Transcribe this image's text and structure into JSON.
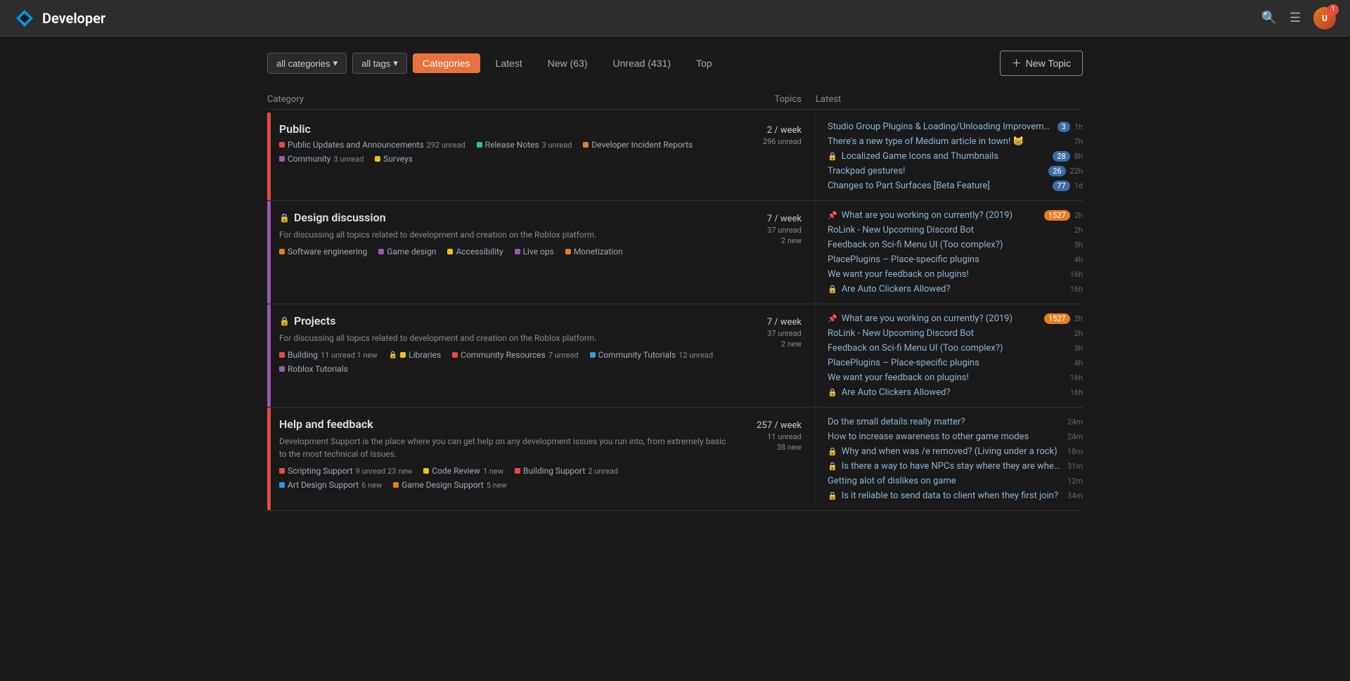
{
  "header": {
    "title": "Developer",
    "search_icon": "🔍",
    "menu_icon": "☰",
    "notification_count": "1"
  },
  "toolbar": {
    "all_categories_label": "all categories",
    "all_tags_label": "all tags",
    "tabs": [
      {
        "id": "categories",
        "label": "Categories",
        "active": true
      },
      {
        "id": "latest",
        "label": "Latest",
        "active": false
      },
      {
        "id": "new",
        "label": "New (63)",
        "active": false
      },
      {
        "id": "unread",
        "label": "Unread (431)",
        "active": false
      },
      {
        "id": "top",
        "label": "Top",
        "active": false
      }
    ],
    "new_topic_label": "New Topic"
  },
  "table": {
    "col_category": "Category",
    "col_topics": "Topics",
    "col_latest": "Latest"
  },
  "categories": [
    {
      "id": "public",
      "name": "Public",
      "color": "#e74c3c",
      "locked": false,
      "stats": {
        "per_week": "2 / week",
        "unread": "296 unread"
      },
      "subcats": [
        {
          "color": "#e74c3c",
          "name": "Public Updates and Announcements",
          "count": "292 unread"
        },
        {
          "color": "#2ecc71",
          "name": "Release Notes",
          "count": "3 unread"
        },
        {
          "color": "#e67e22",
          "name": "Developer Incident Reports",
          "count": ""
        },
        {
          "color": "#9b59b6",
          "name": "Community",
          "count": "3 unread"
        },
        {
          "color": "#f1c40f",
          "name": "Surveys",
          "count": ""
        }
      ],
      "latest": [
        {
          "title": "Studio Group Plugins & Loading/Unloading Improvements",
          "time": "1h",
          "badge": "3",
          "badge_type": "blue",
          "pinned": false,
          "locked": false
        },
        {
          "title": "There's a new type of Medium article in town! 😸",
          "time": "7h",
          "badge": "",
          "badge_type": "",
          "pinned": false,
          "locked": false
        },
        {
          "title": "Localized Game Icons and Thumbnails",
          "time": "8h",
          "badge": "28",
          "badge_type": "blue",
          "pinned": false,
          "locked": true
        },
        {
          "title": "Trackpad gestures!",
          "time": "22h",
          "badge": "26",
          "badge_type": "blue",
          "pinned": false,
          "locked": false
        },
        {
          "title": "Changes to Part Surfaces [Beta Feature]",
          "time": "1d",
          "badge": "77",
          "badge_type": "blue",
          "pinned": false,
          "locked": false
        }
      ]
    },
    {
      "id": "design-discussion",
      "name": "Design discussion",
      "color": "#9b59b6",
      "locked": true,
      "description": "For discussing all topics related to development and creation on the Roblox platform.",
      "stats": {
        "per_week": "7 / week",
        "unread": "37 unread",
        "new": "2 new"
      },
      "subcats": [
        {
          "color": "#e67e22",
          "name": "Software engineering",
          "count": ""
        },
        {
          "color": "#9b59b6",
          "name": "Game design",
          "count": ""
        },
        {
          "color": "#f1c40f",
          "name": "Accessibility",
          "count": ""
        },
        {
          "color": "#9b59b6",
          "name": "Live ops",
          "count": ""
        },
        {
          "color": "#e67e22",
          "name": "Monetization",
          "count": ""
        }
      ],
      "latest": [
        {
          "title": "What are you working on currently? (2019)",
          "time": "2h",
          "badge": "1527",
          "badge_type": "orange",
          "pinned": true,
          "locked": false
        },
        {
          "title": "RoLink - New Upcoming Discord Bot",
          "time": "2h",
          "badge": "",
          "badge_type": "",
          "pinned": false,
          "locked": false
        },
        {
          "title": "Feedback on Sci-fi Menu UI (Too complex?)",
          "time": "3h",
          "badge": "",
          "badge_type": "",
          "pinned": false,
          "locked": false
        },
        {
          "title": "PlacePlugins – Place-specific plugins",
          "time": "4h",
          "badge": "",
          "badge_type": "",
          "pinned": false,
          "locked": false
        },
        {
          "title": "We want your feedback on plugins!",
          "time": "16h",
          "badge": "",
          "badge_type": "",
          "pinned": false,
          "locked": false
        },
        {
          "title": "Are Auto Clickers Allowed?",
          "time": "16h",
          "badge": "",
          "badge_type": "",
          "pinned": false,
          "locked": true
        }
      ]
    },
    {
      "id": "projects",
      "name": "Projects",
      "color": "#9b59b6",
      "locked": true,
      "description": "For discussing all topics related to development and creation on the Roblox platform.",
      "stats": {
        "per_week": "7 / week",
        "unread": "37 unread",
        "new": "2 new"
      },
      "subcats": [
        {
          "color": "#e74c3c",
          "name": "Building",
          "count": "11 unread",
          "extra": "1 new"
        },
        {
          "color": "#f1c40f",
          "name": "Libraries",
          "count": "",
          "locked": true
        },
        {
          "color": "#e74c3c",
          "name": "Community Resources",
          "count": "7 unread"
        },
        {
          "color": "#3498db",
          "name": "Community Tutorials",
          "count": "12 unread"
        },
        {
          "color": "#9b59b6",
          "name": "Roblox Tutorials",
          "count": ""
        }
      ],
      "latest": [
        {
          "title": "What are you working on currently? (2019)",
          "time": "2h",
          "badge": "1527",
          "badge_type": "orange",
          "pinned": true,
          "locked": false
        },
        {
          "title": "RoLink - New Upcoming Discord Bot",
          "time": "2h",
          "badge": "",
          "badge_type": "",
          "pinned": false,
          "locked": false
        },
        {
          "title": "Feedback on Sci-fi Menu UI (Too complex?)",
          "time": "3h",
          "badge": "",
          "badge_type": "",
          "pinned": false,
          "locked": false
        },
        {
          "title": "PlacePlugins – Place-specific plugins",
          "time": "4h",
          "badge": "",
          "badge_type": "",
          "pinned": false,
          "locked": false
        },
        {
          "title": "We want your feedback on plugins!",
          "time": "16h",
          "badge": "",
          "badge_type": "",
          "pinned": false,
          "locked": false
        },
        {
          "title": "Are Auto Clickers Allowed?",
          "time": "16h",
          "badge": "",
          "badge_type": "",
          "pinned": false,
          "locked": true
        }
      ]
    },
    {
      "id": "help-and-feedback",
      "name": "Help and feedback",
      "color": "#e74c3c",
      "locked": false,
      "description": "Development Support is the place where you can get help on any development issues you run into, from extremely basic to the most technical of issues.",
      "stats": {
        "per_week": "257 / week",
        "unread": "11 unread",
        "new": "38 new"
      },
      "subcats": [
        {
          "color": "#e74c3c",
          "name": "Scripting Support",
          "count": "9 unread",
          "extra": "23 new"
        },
        {
          "color": "#f1c40f",
          "name": "Code Review",
          "count": "1 new"
        },
        {
          "color": "#e74c3c",
          "name": "Building Support",
          "count": "2 unread",
          "extra": ""
        },
        {
          "color": "#3498db",
          "name": "Art Design Support",
          "count": "6 new"
        },
        {
          "color": "#e67e22",
          "name": "Game Design Support",
          "count": "5 new"
        }
      ],
      "latest": [
        {
          "title": "Do the small details really matter?",
          "time": "24m",
          "badge": "",
          "badge_type": "",
          "pinned": false,
          "locked": false
        },
        {
          "title": "How to increase awareness to other game modes",
          "time": "24m",
          "badge": "",
          "badge_type": "",
          "pinned": false,
          "locked": false
        },
        {
          "title": "Why and when was /e removed? (Living under a rock)",
          "time": "18m",
          "badge": "",
          "badge_type": "",
          "pinned": false,
          "locked": true
        },
        {
          "title": "Is there a way to have NPCs stay where they are when animatio…",
          "time": "31m",
          "badge": "",
          "badge_type": "",
          "pinned": false,
          "locked": true
        },
        {
          "title": "Getting alot of dislikes on game",
          "time": "12m",
          "badge": "",
          "badge_type": "",
          "pinned": false,
          "locked": false
        },
        {
          "title": "Is it reliable to send data to client when they first join?",
          "time": "34m",
          "badge": "",
          "badge_type": "",
          "pinned": false,
          "locked": true
        }
      ]
    }
  ]
}
